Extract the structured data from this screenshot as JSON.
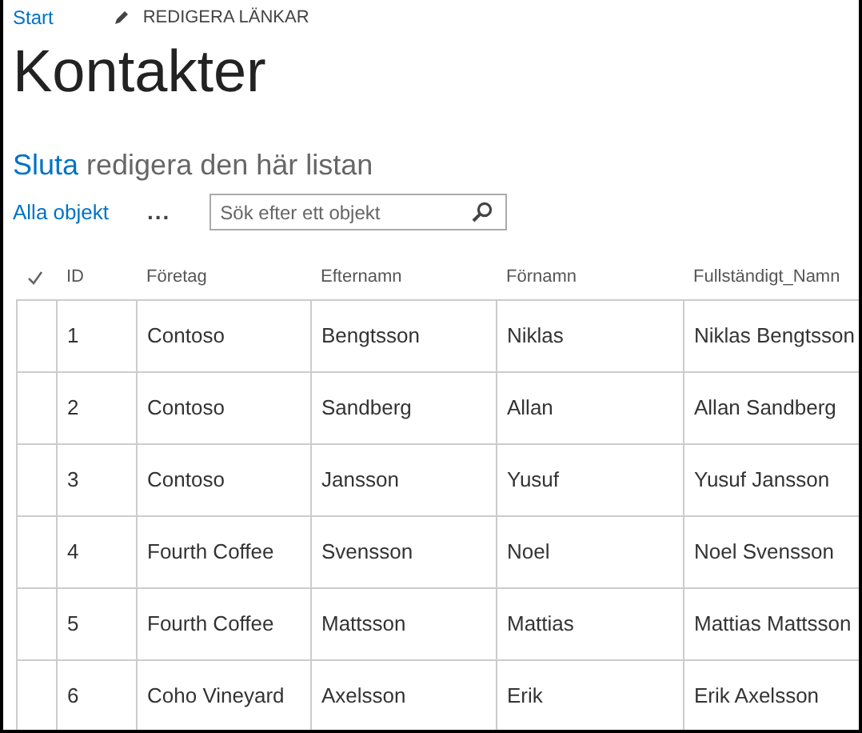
{
  "top_links": [
    {
      "label": "Start",
      "kind": "link"
    },
    {
      "label": "REDIGERA LÄNKAR",
      "kind": "edit"
    }
  ],
  "title": "Kontakter",
  "edit_banner": {
    "link": "Sluta",
    "text": "redigera den här listan"
  },
  "views": {
    "current": "Alla objekt",
    "more": "..."
  },
  "search": {
    "placeholder": "Sök efter ett objekt"
  },
  "table": {
    "columns": [
      "ID",
      "Företag",
      "Efternamn",
      "Förnamn",
      "Fullständigt_Namn"
    ],
    "rows": [
      {
        "cells": [
          "1",
          "Contoso",
          "Bengtsson",
          "Niklas",
          "Niklas Bengtsson"
        ],
        "selected": false
      },
      {
        "cells": [
          "2",
          "Contoso",
          "Sandberg",
          "Allan",
          "Allan Sandberg"
        ],
        "selected": false
      },
      {
        "cells": [
          "3",
          "Contoso",
          "Jansson",
          "Yusuf",
          "Yusuf Jansson"
        ],
        "selected": false
      },
      {
        "cells": [
          "4",
          "Fourth Coffee",
          "Svensson",
          "Noel",
          "Noel Svensson"
        ],
        "selected": false
      },
      {
        "cells": [
          "5",
          "Fourth Coffee",
          "Mattsson",
          "Mattias",
          "Mattias Mattsson"
        ],
        "selected": false
      },
      {
        "cells": [
          "6",
          "Coho Vineyard",
          "Axelsson",
          "Erik",
          "Erik Axelsson"
        ],
        "selected": false
      }
    ]
  }
}
